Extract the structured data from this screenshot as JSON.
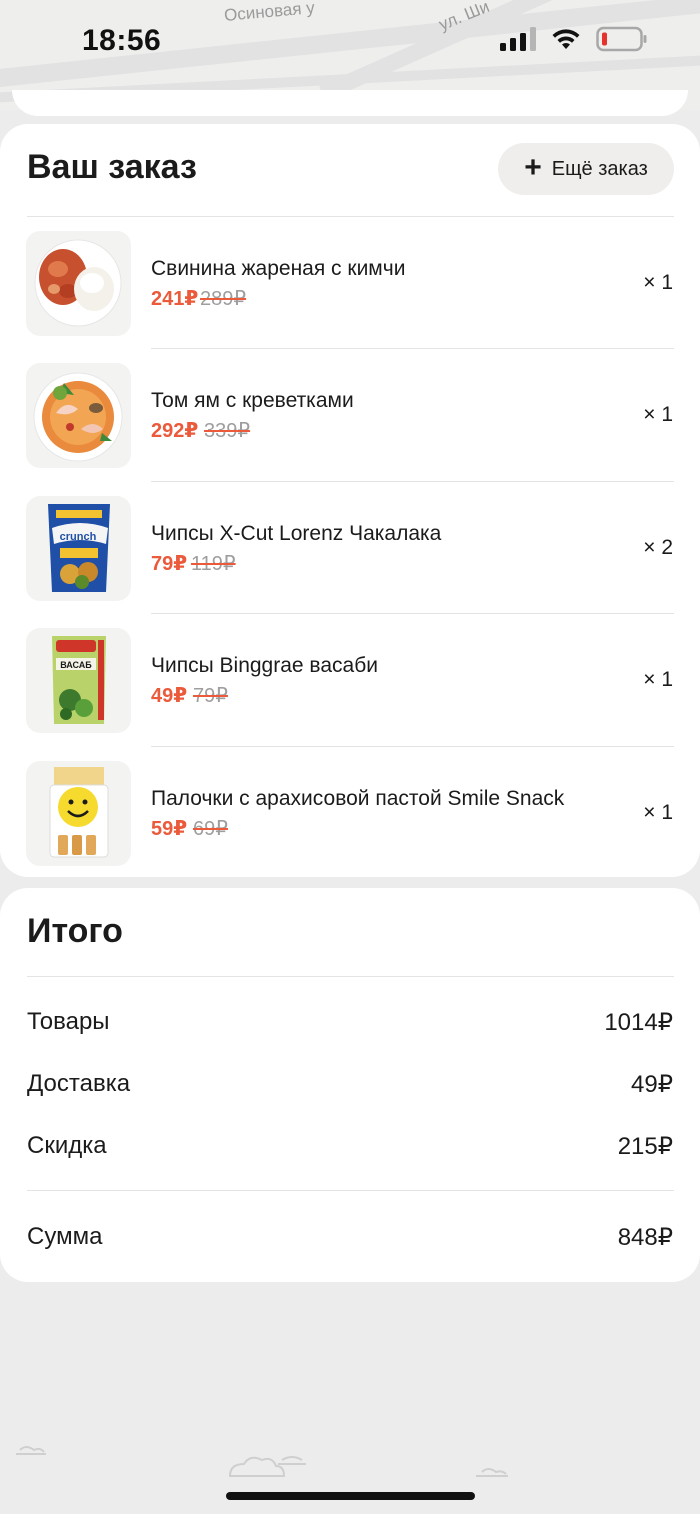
{
  "status_bar": {
    "time": "18:56"
  },
  "map": {
    "street_1": "Осиновая у",
    "street_2": "ул. Ши"
  },
  "order": {
    "title": "Ваш заказ",
    "add_button": "Ещё заказ",
    "items": [
      {
        "name": "Свинина жареная с кимчи",
        "price": "241₽",
        "old_price": "289₽",
        "qty": "× 1",
        "image": "pork-kimchi-dish"
      },
      {
        "name": "Том ям с креветками",
        "price": "292₽",
        "old_price": "339₽",
        "qty": "× 1",
        "image": "tom-yum-soup"
      },
      {
        "name": "Чипсы X-Cut Lorenz Чакалака",
        "price": "79₽",
        "old_price": "119₽",
        "qty": "× 2",
        "image": "crunchips-pack"
      },
      {
        "name": "Чипсы Binggrae васаби",
        "price": "49₽",
        "old_price": "79₽",
        "qty": "× 1",
        "image": "binggrae-wasabi-pack"
      },
      {
        "name": "Палочки с арахисовой пастой Smile Snack",
        "price": "59₽",
        "old_price": "69₽",
        "qty": "× 1",
        "image": "smile-snack-box"
      }
    ]
  },
  "summary": {
    "title": "Итого",
    "rows": [
      {
        "label": "Товары",
        "value": "1014₽"
      },
      {
        "label": "Доставка",
        "value": "49₽"
      },
      {
        "label": "Скидка",
        "value": "215₽"
      }
    ],
    "total": {
      "label": "Сумма",
      "value": "848₽"
    }
  },
  "colors": {
    "accent_price": "#ea5a3b",
    "old_price": "#9e9e9e",
    "background": "#ececec",
    "card": "#ffffff"
  }
}
